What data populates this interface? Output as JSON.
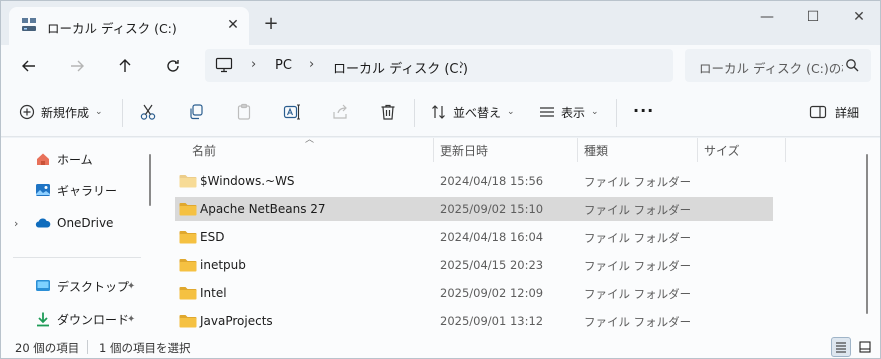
{
  "tab": {
    "title": "ローカル ディスク (C:)",
    "close_glyph": "✕",
    "new_tab_glyph": "+"
  },
  "window_controls": {
    "minimize": "—",
    "maximize": "☐",
    "close": "✕"
  },
  "address": {
    "crumbs": [
      "PC",
      "ローカル ディスク (C:)"
    ],
    "chevron": "›"
  },
  "search": {
    "placeholder": "ローカル ディスク (C:)の検索"
  },
  "toolbar": {
    "new_label": "新規作成",
    "sort_label": "並べ替え",
    "view_label": "表示",
    "more_label": "···",
    "details_label": "詳細"
  },
  "sidebar": {
    "items": [
      {
        "label": "ホーム",
        "icon": "home-icon"
      },
      {
        "label": "ギャラリー",
        "icon": "gallery-icon"
      },
      {
        "label": "OneDrive",
        "icon": "onedrive-icon",
        "expander": "›"
      },
      {
        "label": "デスクトップ",
        "icon": "desktop-icon",
        "pin": "📌"
      },
      {
        "label": "ダウンロード",
        "icon": "download-icon",
        "pin": "📌"
      }
    ]
  },
  "columns": {
    "name": "名前",
    "date": "更新日時",
    "type": "種類",
    "size": "サイズ"
  },
  "files": [
    {
      "name": "$Windows.~WS",
      "date": "2024/04/18 15:56",
      "type": "ファイル フォルダー",
      "selected": false,
      "faded": true
    },
    {
      "name": "Apache NetBeans 27",
      "date": "2025/09/02 15:10",
      "type": "ファイル フォルダー",
      "selected": true,
      "faded": false
    },
    {
      "name": "ESD",
      "date": "2024/04/18 16:04",
      "type": "ファイル フォルダー",
      "selected": false,
      "faded": false
    },
    {
      "name": "inetpub",
      "date": "2025/04/15 20:23",
      "type": "ファイル フォルダー",
      "selected": false,
      "faded": false
    },
    {
      "name": "Intel",
      "date": "2025/09/02 12:09",
      "type": "ファイル フォルダー",
      "selected": false,
      "faded": false
    },
    {
      "name": "JavaProjects",
      "date": "2025/09/01 13:12",
      "type": "ファイル フォルダー",
      "selected": false,
      "faded": false
    }
  ],
  "status": {
    "item_count": "20 個の項目",
    "selection": "1 個の項目を選択"
  },
  "colors": {
    "folder": "#f5c142",
    "folder_dark": "#e0a82e",
    "selected_row": "#d9d9d9",
    "onedrive": "#0f6cbd",
    "accent": "#0067c0"
  }
}
